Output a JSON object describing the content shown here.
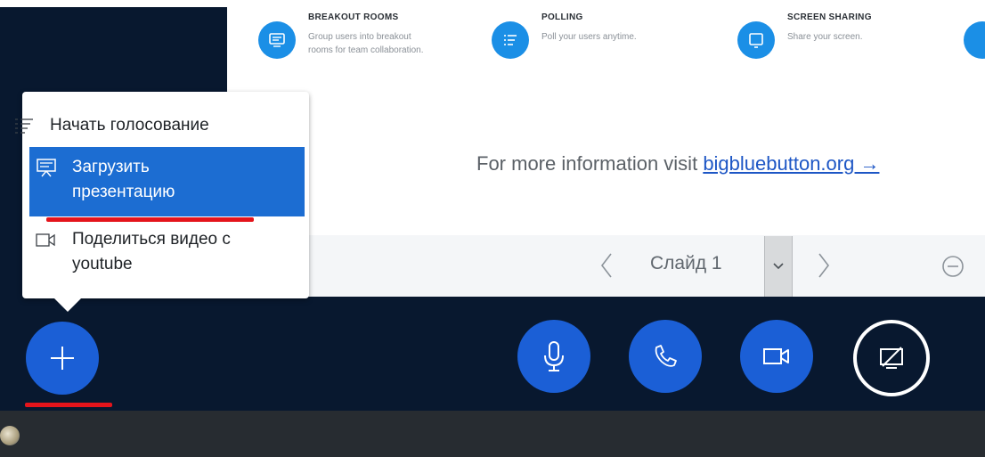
{
  "features": [
    {
      "title": "BREAKOUT ROOMS",
      "description": "Group users into breakout rooms for team collaboration.",
      "icon": "breakout-rooms-icon"
    },
    {
      "title": "POLLING",
      "description": "Poll your users anytime.",
      "icon": "polling-icon"
    },
    {
      "title": "SCREEN SHARING",
      "description": "Share your screen.",
      "icon": "screen-sharing-icon"
    }
  ],
  "slide": {
    "info_text": "For more information visit",
    "info_link": "bigbluebutton.org →"
  },
  "slide_toolbar": {
    "slide_label": "Слайд 1"
  },
  "actions_menu": {
    "items": [
      {
        "label": "Начать голосование",
        "icon": "poll-list-icon"
      },
      {
        "label": "Загрузить\nпрезентацию",
        "icon": "presentation-icon",
        "active": true
      },
      {
        "label": "Поделиться видео с\nyoutube",
        "icon": "video-icon"
      }
    ]
  },
  "controls": {
    "actions_button": "plus-icon",
    "microphone": "microphone-icon",
    "phone": "phone-icon",
    "camera": "camera-icon",
    "screen_share": "screen-share-off-icon"
  },
  "colors": {
    "dark_background": "#08182f",
    "accent_blue": "#1b5fd6",
    "feature_blue": "#1b8fe6",
    "menu_active": "#1c6dd2",
    "highlight_red": "#e4141b"
  }
}
